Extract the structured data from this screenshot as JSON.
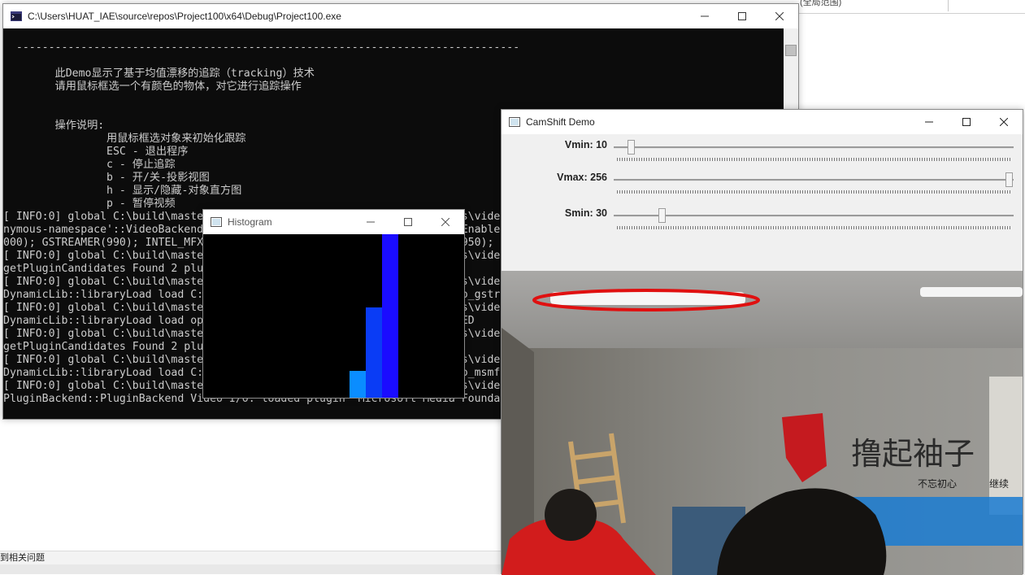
{
  "ide": {
    "status_text": "到相关问题",
    "top_text": "(全局范围)"
  },
  "console": {
    "title": "C:\\Users\\HUAT_IAE\\source\\repos\\Project100\\x64\\Debug\\Project100.exe",
    "lines": [
      "  ------------------------------------------------------------------------------",
      "",
      "        此Demo显示了基于均值漂移的追踪（tracking）技术",
      "        请用鼠标框选一个有颜色的物体，对它进行追踪操作",
      "",
      "",
      "        操作说明:",
      "                用鼠标框选对象来初始化跟踪",
      "                ESC - 退出程序",
      "                c - 停止追踪",
      "                b - 开/关-投影视图",
      "                h - 显示/隐藏-对象直方图",
      "                p - 暂停视频",
      "[ INFO:0] global C:\\build\\master_winpack-build-win64-vc15\\opencv\\modules\\videoio\\src\\video",
      "nymous-namespace'::VideoBackendRegistry::VideoBackendRegistry VIDEOIO: Enabled",
      "000); GSTREAMER(990); INTEL_MFX(980); MSMF(970); DSHOW(960); CV_IMAGES(950);",
      "[ INFO:0] global C:\\build\\master_winpack-build-win64-vc15\\opencv\\modules\\videoio\\src\\video",
      "getPluginCandidates Found 2 plugin(s) for GSTREAMER",
      "[ INFO:0] global C:\\build\\master_winpack-build-win64-vc15\\opencv\\modules\\videoio\\src\\video",
      "DynamicLib::libraryLoad load C:\\opencv\\build\\x64\\vc15\\bin\\opencv_videoio_gstreamer450_",
      "[ INFO:0] global C:\\build\\master_winpack-build-win64-vc15\\opencv\\modules\\videoio\\src\\video",
      "DynamicLib::libraryLoad load opencv_videoio_gstreamer450_64.dll => FAILED",
      "[ INFO:0] global C:\\build\\master_winpack-build-win64-vc15\\opencv\\modules\\videoio\\src\\video",
      "getPluginCandidates Found 2 plugin(s) for MSMF",
      "[ INFO:0] global C:\\build\\master_winpack-build-win64-vc15\\opencv\\modules\\videoio\\src\\video",
      "DynamicLib::libraryLoad load C:\\opencv\\build\\x64\\vc15\\bin\\opencv_videoio_msmf450_64d.dll",
      "[ INFO:0] global C:\\build\\master_winpack-build-win64-vc15\\opencv\\modules\\videoio\\src\\video",
      "PluginBackend::PluginBackend Video I/O: loaded plugin 'Microsoft Media Foundation'"
    ]
  },
  "histogram": {
    "title": "Histogram",
    "bins": [
      {
        "value": 0.165,
        "color": "#0a8dff"
      },
      {
        "value": 0.55,
        "color": "#0a3cf5"
      },
      {
        "value": 1.0,
        "color": "#1a0cff"
      }
    ]
  },
  "camshift": {
    "title": "CamShift Demo",
    "trackbars": [
      {
        "label": "Vmin: 10",
        "value": 10,
        "max": 256
      },
      {
        "label": "Vmax: 256",
        "value": 256,
        "max": 256
      },
      {
        "label": "Smin: 30",
        "value": 30,
        "max": 256
      }
    ],
    "scene": {
      "banner_text": "撸起袖子",
      "sub_text_1": "不忘初心",
      "sub_text_2": "继续",
      "tracking_color": "#e01010"
    }
  },
  "icons": {
    "console": "console-app-icon",
    "window": "opencv-window-icon",
    "minimize": "minimize-icon",
    "maximize": "maximize-icon",
    "close": "close-icon"
  }
}
